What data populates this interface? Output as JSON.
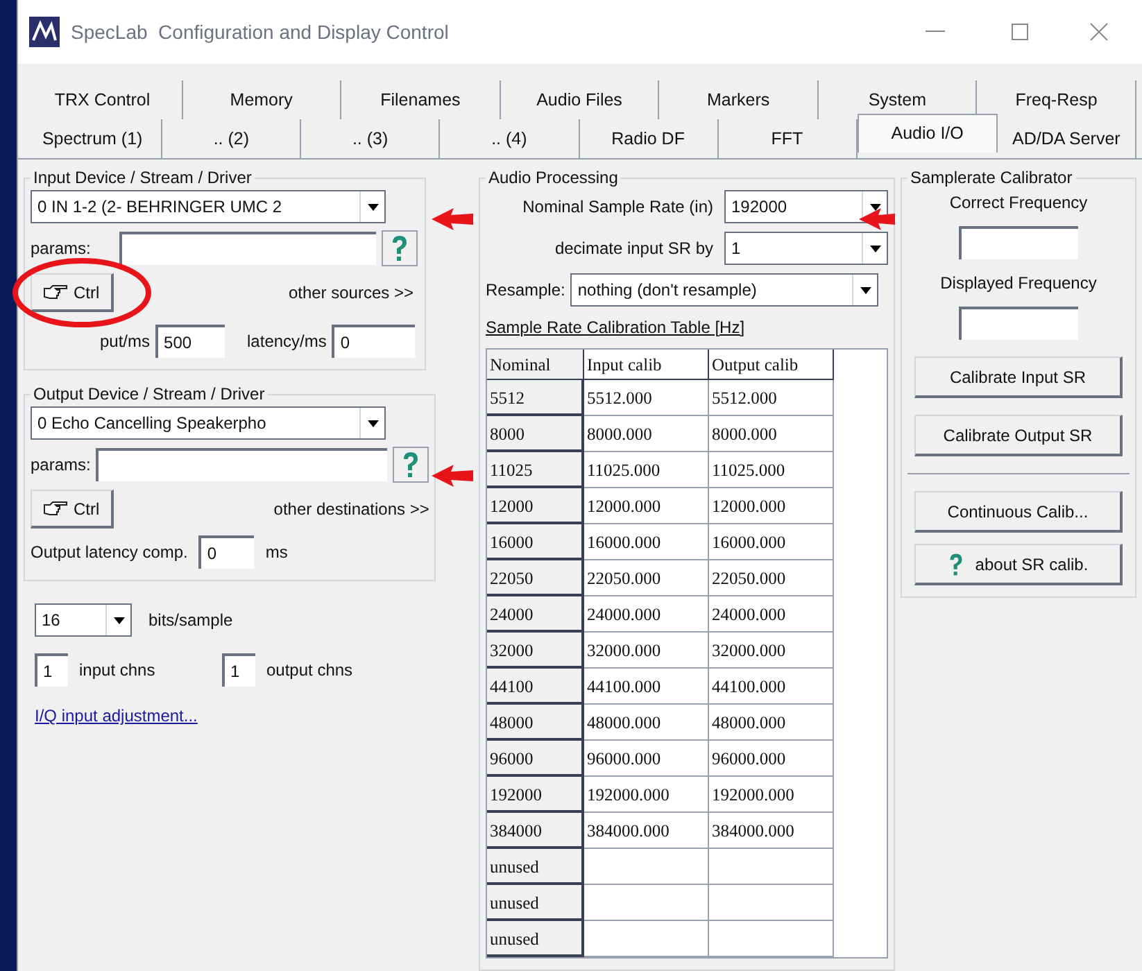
{
  "window": {
    "title": "SpecLab  Configuration and Display Control"
  },
  "tab_rows": [
    [
      {
        "label": "TRX Control",
        "selected": false
      },
      {
        "label": "Memory",
        "selected": false
      },
      {
        "label": "Filenames",
        "selected": false
      },
      {
        "label": "Audio Files",
        "selected": false
      },
      {
        "label": "Markers",
        "selected": false
      },
      {
        "label": "System",
        "selected": false
      },
      {
        "label": "Freq-Resp",
        "selected": false
      }
    ],
    [
      {
        "label": "Spectrum (1)",
        "selected": false
      },
      {
        "label": ".. (2)",
        "selected": false
      },
      {
        "label": ".. (3)",
        "selected": false
      },
      {
        "label": ".. (4)",
        "selected": false
      },
      {
        "label": "Radio DF",
        "selected": false
      },
      {
        "label": "FFT",
        "selected": false
      },
      {
        "label": "Audio I/O",
        "selected": true
      },
      {
        "label": "AD/DA Server",
        "selected": false
      }
    ]
  ],
  "input_group": {
    "title": "Input Device / Stream / Driver",
    "device": "0 IN 1-2 (2- BEHRINGER UMC 2",
    "params_label": "params:",
    "ctrl_button": "Ctrl",
    "other_link": "other sources >>",
    "buffer_label": "put/ms",
    "buffer_value": "500",
    "latency_label": "latency/ms",
    "latency_value": "0"
  },
  "output_group": {
    "title": "Output Device / Stream / Driver",
    "device": "0 Echo Cancelling Speakerpho",
    "params_label": "params:",
    "ctrl_button": "Ctrl",
    "other_link": "other destinations >>",
    "latency_label": "Output latency comp.",
    "latency_value": "0",
    "unit": "ms"
  },
  "bits": {
    "value": "16",
    "label": "bits/sample"
  },
  "input_chns": {
    "value": "1",
    "label": "input chns"
  },
  "output_chns": {
    "value": "1",
    "label": "output chns"
  },
  "iq_link": "I/Q input adjustment...",
  "audio_processing": {
    "title": "Audio Processing",
    "fields": [
      {
        "label": "Nominal Sample Rate (in)",
        "value": "192000"
      },
      {
        "label": "decimate input SR by",
        "value": "1"
      }
    ],
    "resample": {
      "label": "Resample:",
      "value": "nothing (don't resample)"
    },
    "table": {
      "title": "Sample Rate Calibration Table [Hz]",
      "columns": [
        "Nominal",
        "Input calib",
        "Output calib"
      ],
      "rows": [
        [
          "5512",
          "5512.000",
          "5512.000"
        ],
        [
          "8000",
          "8000.000",
          "8000.000"
        ],
        [
          "11025",
          "11025.000",
          "11025.000"
        ],
        [
          "12000",
          "12000.000",
          "12000.000"
        ],
        [
          "16000",
          "16000.000",
          "16000.000"
        ],
        [
          "22050",
          "22050.000",
          "22050.000"
        ],
        [
          "24000",
          "24000.000",
          "24000.000"
        ],
        [
          "32000",
          "32000.000",
          "32000.000"
        ],
        [
          "44100",
          "44100.000",
          "44100.000"
        ],
        [
          "48000",
          "48000.000",
          "48000.000"
        ],
        [
          "96000",
          "96000.000",
          "96000.000"
        ],
        [
          "192000",
          "192000.000",
          "192000.000"
        ],
        [
          "384000",
          "384000.000",
          "384000.000"
        ],
        [
          "unused",
          "",
          ""
        ],
        [
          "unused",
          "",
          ""
        ],
        [
          "unused",
          "",
          ""
        ]
      ]
    }
  },
  "calibrator": {
    "title": "Samplerate Calibrator",
    "correct_label": "Correct Frequency",
    "displayed_label": "Displayed Frequency",
    "buttons": [
      "Calibrate Input SR",
      "Calibrate Output SR"
    ],
    "continuous_button": "Continuous Calib...",
    "about_button": "about SR calib."
  }
}
